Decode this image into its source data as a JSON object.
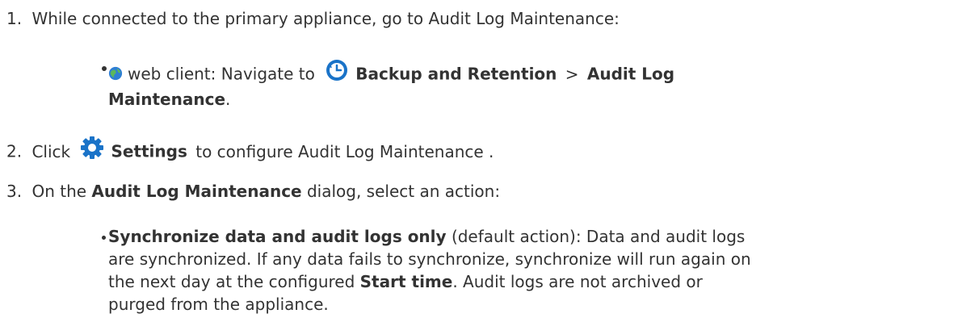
{
  "steps": [
    {
      "number": "1.",
      "text_a": "While connected to the primary appliance, go to Audit Log Maintenance:",
      "sub": {
        "client": "web client: Navigate to",
        "path_1": "Backup and Retention",
        "sep": ">",
        "path_2a": "Audit Log",
        "path_2b": "Maintenance",
        "end": "."
      }
    },
    {
      "number": "2.",
      "text_a": "Click",
      "bold": "Settings",
      "text_b": "to configure Audit Log Maintenance ."
    },
    {
      "number": "3.",
      "text_a": "On the",
      "bold": "Audit Log Maintenance",
      "text_b": "dialog, select an action:",
      "sub": {
        "bold_a": "Synchronize data and audit logs only",
        "line1_rest": "(default action): Data and audit logs",
        "line2": "are synchronized. If any data fails to synchronize, synchronize will run again on",
        "line3_a": "the next day at the configured",
        "line3_bold": "Start time",
        "line3_b": ". Audit logs are not archived or",
        "line4": "purged from the appliance."
      }
    }
  ],
  "icons": {
    "globe": "globe-icon",
    "backup": "backup-retention-icon",
    "settings": "gear-icon"
  },
  "colors": {
    "text": "#333333",
    "icon_blue": "#1a73c8",
    "globe_green": "#4caf50"
  }
}
